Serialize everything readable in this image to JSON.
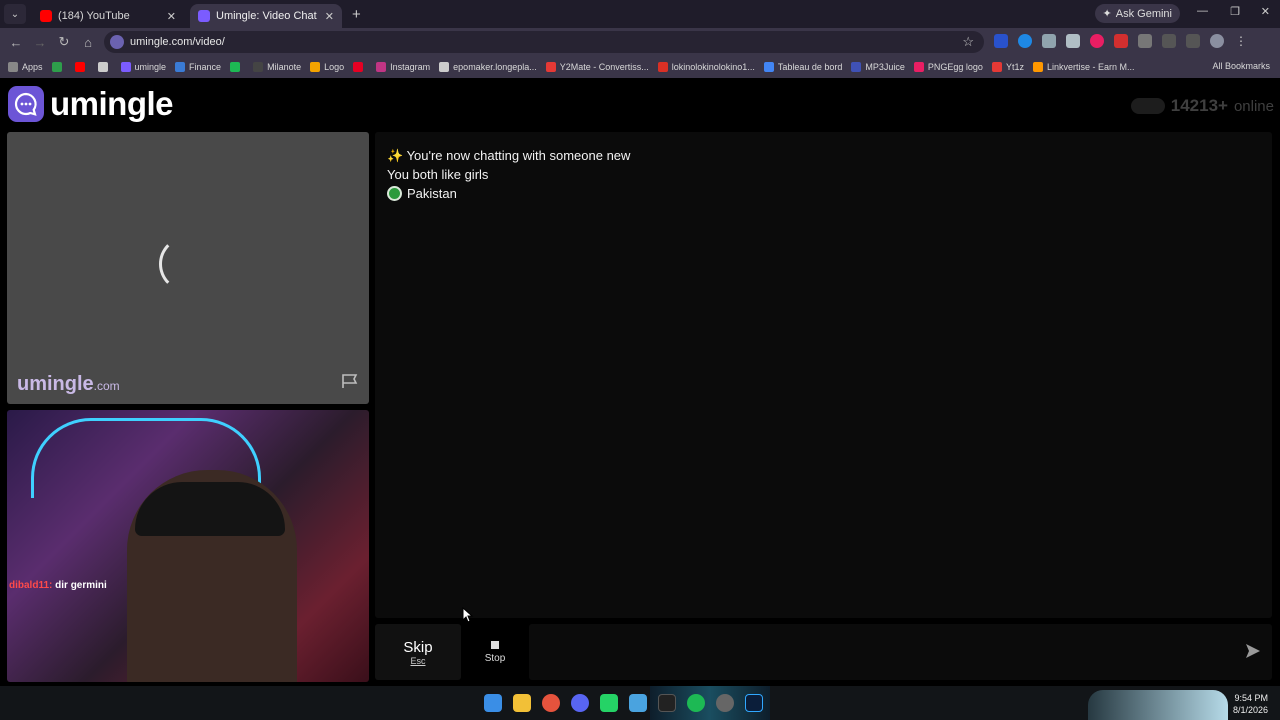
{
  "browser": {
    "tabs": [
      {
        "title": "(184) YouTube",
        "favicon_color": "#ff0000",
        "active": false
      },
      {
        "title": "Umingle: Video Chat with S",
        "favicon_color": "#7b5cff",
        "active": true
      }
    ],
    "ask_gemini": "Ask Gemini",
    "url": "umingle.com/video/",
    "bookmarks": [
      {
        "label": "Apps",
        "color": "#888888"
      },
      {
        "label": "",
        "color": "#2e9e4b"
      },
      {
        "label": "",
        "color": "#ff0000"
      },
      {
        "label": "",
        "color": "#cccccc"
      },
      {
        "label": "umingle",
        "color": "#7b5cff"
      },
      {
        "label": "Finance",
        "color": "#3a7bd5"
      },
      {
        "label": "",
        "color": "#1db954"
      },
      {
        "label": "Milanote",
        "color": "#444444"
      },
      {
        "label": "Logo",
        "color": "#f4a300"
      },
      {
        "label": "",
        "color": "#e60023"
      },
      {
        "label": "Instagram",
        "color": "#c13584"
      },
      {
        "label": "epomaker.longepla...",
        "color": "#cccccc"
      },
      {
        "label": "Y2Mate - Convertiss...",
        "color": "#e53935"
      },
      {
        "label": "lokinolokinolokino1...",
        "color": "#d93025"
      },
      {
        "label": "Tableau de bord",
        "color": "#4285f4"
      },
      {
        "label": "MP3Juice",
        "color": "#3f51b5"
      },
      {
        "label": "PNGEgg logo",
        "color": "#e91e63"
      },
      {
        "label": "Yt1z",
        "color": "#e53935"
      },
      {
        "label": "Linkvertise - Earn M...",
        "color": "#ff9800"
      }
    ],
    "all_bookmarks": "All Bookmarks"
  },
  "site": {
    "logo_text": "umingle",
    "online_count": "14213+",
    "online_label": "online",
    "watermark_main": "umingle",
    "watermark_suffix": ".com",
    "stream_overlay_user": "dibald11:",
    "stream_overlay_text": "dir germini"
  },
  "chat": {
    "messages": [
      {
        "icon": "sparkles-icon",
        "text": "✨ You're now chatting with someone new"
      },
      {
        "icon": "",
        "text": "You both like girls"
      },
      {
        "icon": "country-icon",
        "text": "Pakistan"
      }
    ],
    "input_placeholder": ""
  },
  "controls": {
    "skip_label": "Skip",
    "skip_key": "Esc",
    "stop_label": "Stop"
  },
  "taskbar": {
    "time": "9:54 PM",
    "date": "8/1/2026"
  },
  "colors": {
    "accent": "#6c55d6",
    "page_bg": "#000000",
    "chat_bg": "#0b0b0b"
  }
}
